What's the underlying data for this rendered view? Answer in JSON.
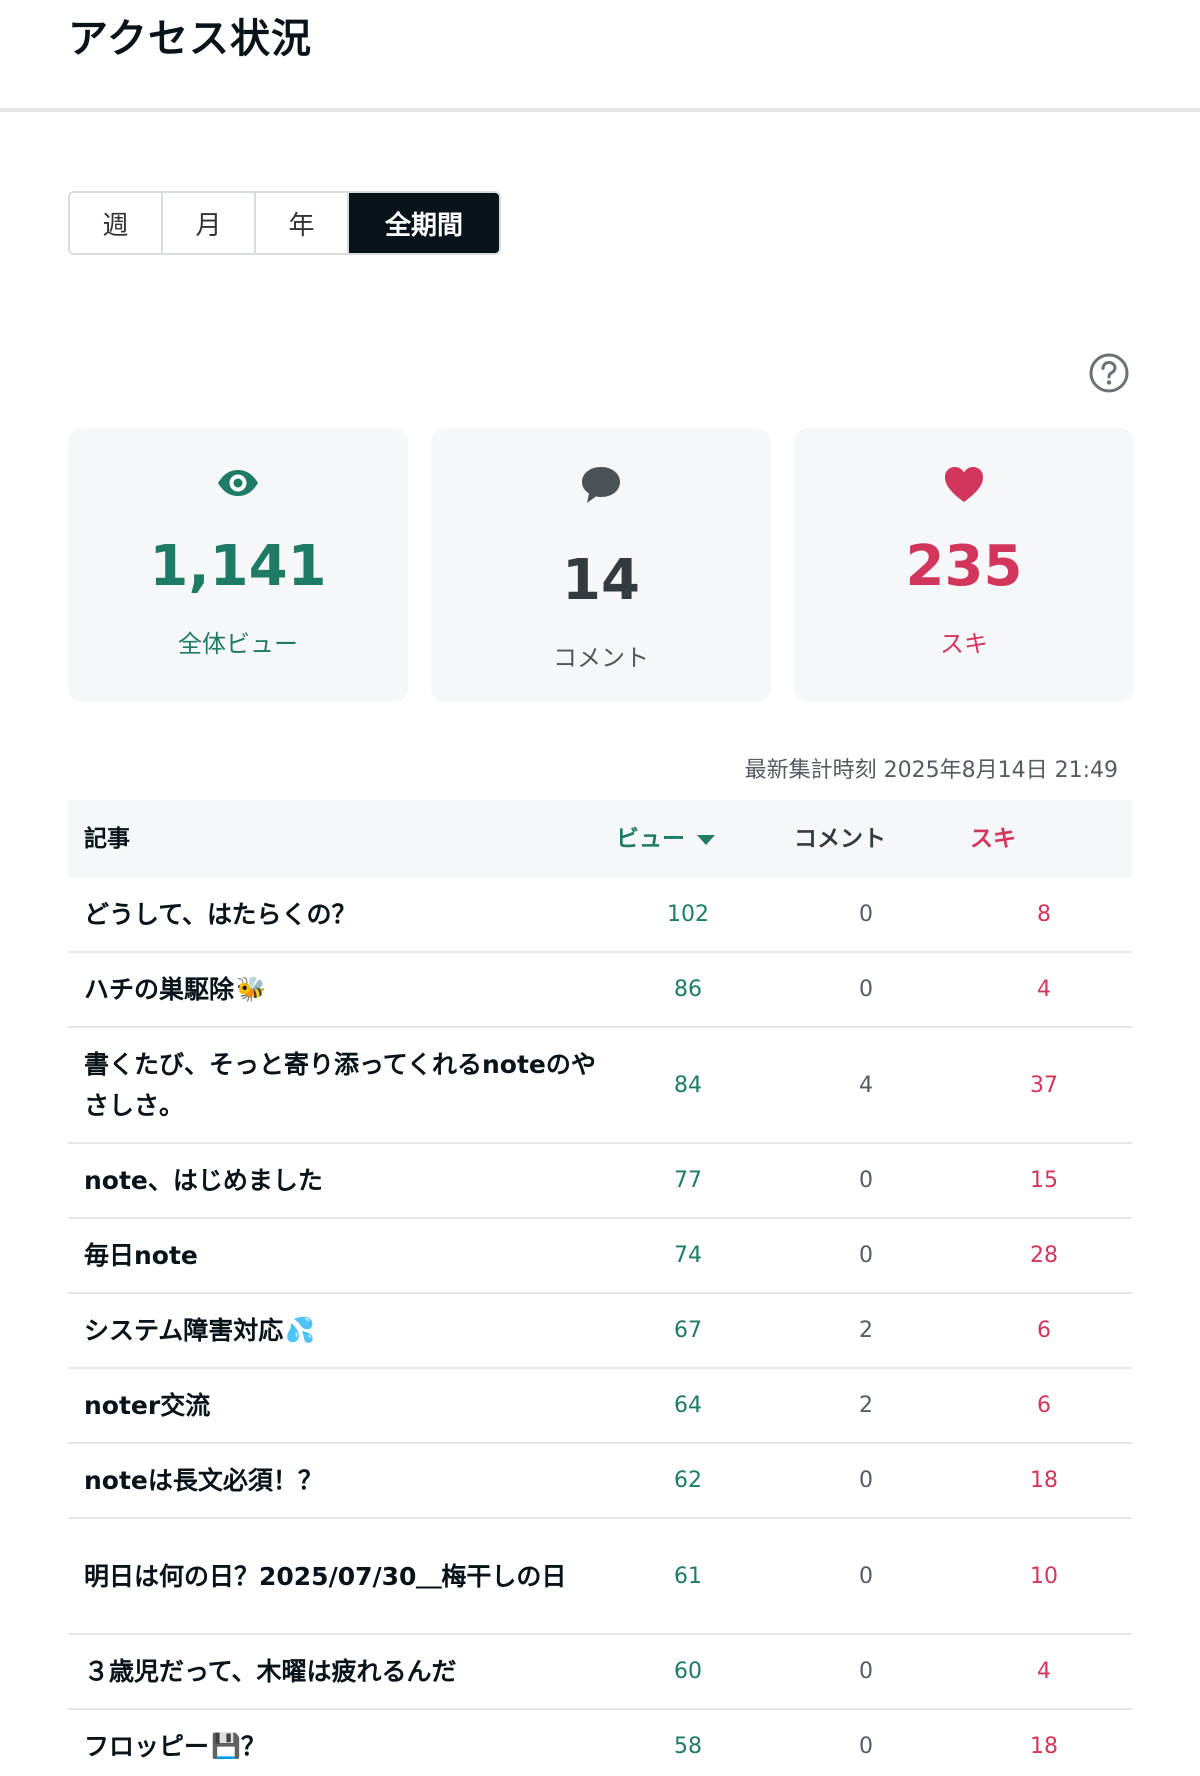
{
  "header": {
    "title": "アクセス状況"
  },
  "period_tabs": [
    {
      "label": "週",
      "active": false
    },
    {
      "label": "月",
      "active": false
    },
    {
      "label": "年",
      "active": false
    },
    {
      "label": "全期間",
      "active": true
    }
  ],
  "summary": {
    "views": {
      "value": "1,141",
      "label": "全体ビュー",
      "icon": "eye-icon",
      "color": "#1e7b65"
    },
    "comments": {
      "value": "14",
      "label": "コメント",
      "icon": "speech-bubble-icon",
      "color": "#333b3f"
    },
    "likes": {
      "value": "235",
      "label": "スキ",
      "icon": "heart-icon",
      "color": "#d3365c"
    }
  },
  "updated": "最新集計時刻 2025年8月14日 21:49",
  "table": {
    "columns": {
      "article": "記事",
      "views": "ビュー",
      "comments": "コメント",
      "likes": "スキ"
    },
    "rows": [
      {
        "title": "どうして、はたらくの？",
        "views": "102",
        "comments": "0",
        "likes": "8"
      },
      {
        "title": "ハチの巣駆除",
        "emoji": "🐝",
        "views": "86",
        "comments": "0",
        "likes": "4"
      },
      {
        "title": "書くたび、そっと寄り添ってくれるnoteのやさしさ。",
        "views": "84",
        "comments": "4",
        "likes": "37"
      },
      {
        "title": "note、はじめました",
        "views": "77",
        "comments": "0",
        "likes": "15"
      },
      {
        "title": "毎日note",
        "views": "74",
        "comments": "0",
        "likes": "28"
      },
      {
        "title": "システム障害対応",
        "emoji": "💦",
        "views": "67",
        "comments": "2",
        "likes": "6"
      },
      {
        "title": "noter交流",
        "views": "64",
        "comments": "2",
        "likes": "6"
      },
      {
        "title": "noteは長文必須！？",
        "views": "62",
        "comments": "0",
        "likes": "18"
      },
      {
        "title": "明日は何の日？2025/07/30＿梅干しの日",
        "views": "61",
        "comments": "0",
        "likes": "10"
      },
      {
        "title": "３歳児だって、木曜は疲れるんだ",
        "views": "60",
        "comments": "0",
        "likes": "4"
      },
      {
        "title": "フロッピー",
        "emoji": "💾",
        "title_suffix": "？",
        "views": "58",
        "comments": "0",
        "likes": "18"
      }
    ]
  }
}
